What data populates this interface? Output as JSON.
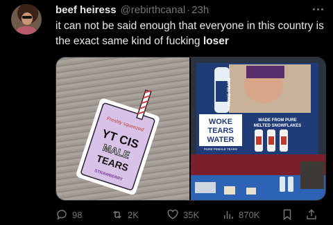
{
  "tweet": {
    "display_name": "beef heiress",
    "handle": "@rebirthcanal",
    "separator": "·",
    "time": "23h",
    "text_part1": "it can not be said enough that everyone in this country is the exact same kind of fucking ",
    "text_bold": "loser"
  },
  "media": {
    "sticker": {
      "brand": "Freshly squeezed",
      "line1": "YT CIS",
      "line2": "MALE",
      "line3": "TEARS",
      "flavor": "STRAWBERRY",
      "color": "#d9c2e8"
    },
    "booth": {
      "bottle_label": "WOKE TEARS",
      "sign_line1": "WOKE",
      "sign_line2": "TEARS",
      "sign_line3": "WATER",
      "tagline_line1": "MADE FROM PURE",
      "tagline_line2": "MELTED SNOWFLAKES",
      "small_print": "PURE FEMALE TEARS",
      "banner_color": "#1f3b78"
    }
  },
  "actions": {
    "replies": "98",
    "retweets": "2K",
    "likes": "35K",
    "views": "870K"
  },
  "icons": [
    "reply-icon",
    "retweet-icon",
    "like-icon",
    "views-icon",
    "bookmark-icon",
    "share-icon",
    "more-icon"
  ]
}
